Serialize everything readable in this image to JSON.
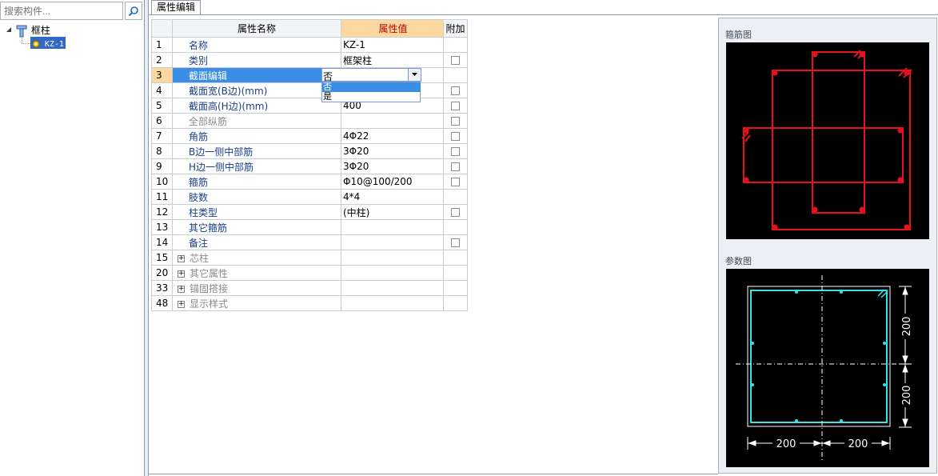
{
  "search": {
    "placeholder": "搜索构件..."
  },
  "tree": {
    "root_label": "框柱",
    "child_label": "KZ-1"
  },
  "tab": {
    "label": "属性编辑"
  },
  "grid": {
    "headers": {
      "name": "属性名称",
      "value": "属性值",
      "extra": "附加"
    },
    "rows": [
      {
        "num": "1",
        "name": "名称",
        "value": "KZ-1",
        "checkbox": false,
        "gray": false
      },
      {
        "num": "2",
        "name": "类别",
        "value": "框架柱",
        "checkbox": true,
        "gray": false
      },
      {
        "num": "3",
        "name": "截面编辑",
        "value": "否",
        "checkbox": false,
        "gray": false,
        "selected": true
      },
      {
        "num": "4",
        "name": "截面宽(B边)(mm)",
        "value": "",
        "checkbox": true,
        "gray": false
      },
      {
        "num": "5",
        "name": "截面高(H边)(mm)",
        "value": "400",
        "checkbox": true,
        "gray": false
      },
      {
        "num": "6",
        "name": "全部纵筋",
        "value": "",
        "checkbox": true,
        "gray": true
      },
      {
        "num": "7",
        "name": "角筋",
        "value": "4Φ22",
        "checkbox": true,
        "gray": false
      },
      {
        "num": "8",
        "name": "B边一侧中部筋",
        "value": "3Φ20",
        "checkbox": true,
        "gray": false
      },
      {
        "num": "9",
        "name": "H边一侧中部筋",
        "value": "3Φ20",
        "checkbox": true,
        "gray": false
      },
      {
        "num": "10",
        "name": "箍筋",
        "value": "Φ10@100/200",
        "checkbox": true,
        "gray": false
      },
      {
        "num": "11",
        "name": "肢数",
        "value": "4*4",
        "checkbox": false,
        "gray": false
      },
      {
        "num": "12",
        "name": "柱类型",
        "value": "(中柱)",
        "checkbox": true,
        "gray": false
      },
      {
        "num": "13",
        "name": "其它箍筋",
        "value": "",
        "checkbox": false,
        "gray": false
      },
      {
        "num": "14",
        "name": "备注",
        "value": "",
        "checkbox": true,
        "gray": false
      }
    ],
    "groups": [
      {
        "num": "15",
        "name": "芯柱"
      },
      {
        "num": "20",
        "name": "其它属性"
      },
      {
        "num": "33",
        "name": "锚固搭接"
      },
      {
        "num": "48",
        "name": "显示样式"
      }
    ]
  },
  "combo": {
    "value": "否",
    "options": [
      "否",
      "是"
    ]
  },
  "panels": {
    "stirrup_title": "箍筋图",
    "param_title": "参数图",
    "dim_labels": [
      "200",
      "200",
      "200",
      "200"
    ]
  },
  "colors": {
    "stirrup_red": "#e8101c",
    "param_cyan": "#2fe3e8",
    "selection_blue": "#3a8ee6",
    "header_orange": "#fcd89e"
  }
}
